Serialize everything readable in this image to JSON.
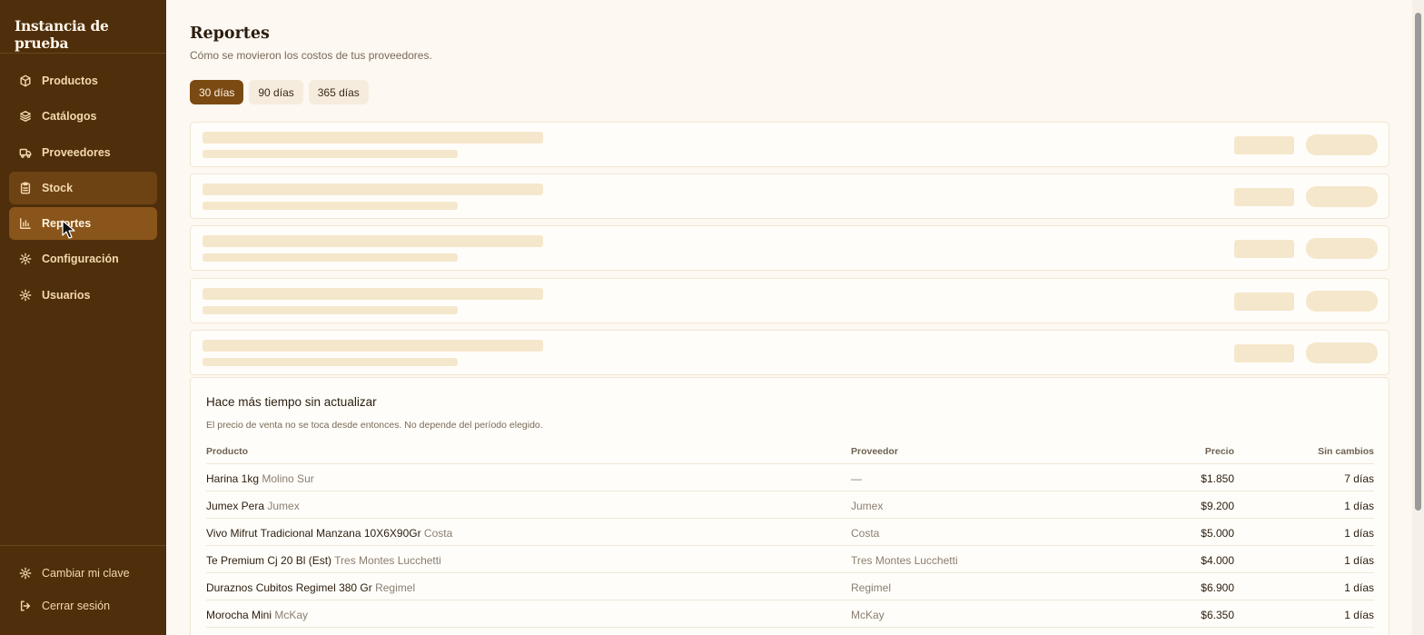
{
  "sidebar": {
    "brand": "Instancia de prueba",
    "items": [
      {
        "label": "Productos",
        "icon": "box-icon"
      },
      {
        "label": "Catálogos",
        "icon": "layers-icon"
      },
      {
        "label": "Proveedores",
        "icon": "truck-icon"
      },
      {
        "label": "Stock",
        "icon": "clipboard-icon"
      },
      {
        "label": "Reportes",
        "icon": "bar-chart-icon"
      },
      {
        "label": "Configuración",
        "icon": "gear-icon"
      },
      {
        "label": "Usuarios",
        "icon": "gear-icon"
      }
    ],
    "bottom": [
      {
        "label": "Cambiar mi clave",
        "icon": "gear-icon"
      },
      {
        "label": "Cerrar sesión",
        "icon": "logout-icon"
      }
    ]
  },
  "header": {
    "title": "Reportes",
    "subtitle": "Cómo se movieron los costos de tus proveedores."
  },
  "tabs": [
    "30 días",
    "90 días",
    "365 días"
  ],
  "panel": {
    "title": "Hace más tiempo sin actualizar",
    "subtitle": "El precio de venta no se toca desde entonces. No depende del período elegido.",
    "columns": {
      "product": "Producto",
      "supplier": "Proveedor",
      "price": "Precio",
      "days": "Sin cambios"
    },
    "rows": [
      {
        "product": "Harina 1kg",
        "brand": "Molino Sur",
        "supplier": "—",
        "price": "$1.850",
        "days": "7 días"
      },
      {
        "product": "Jumex Pera",
        "brand": "Jumex",
        "supplier": "Jumex",
        "price": "$9.200",
        "days": "1 días"
      },
      {
        "product": "Vivo Mifrut Tradicional Manzana 10X6X90Gr",
        "brand": "Costa",
        "supplier": "Costa",
        "price": "$5.000",
        "days": "1 días"
      },
      {
        "product": "Te Premium Cj 20 Bl (Est)",
        "brand": "Tres Montes Lucchetti",
        "supplier": "Tres Montes Lucchetti",
        "price": "$4.000",
        "days": "1 días"
      },
      {
        "product": "Duraznos Cubitos Regimel 380 Gr",
        "brand": "Regimel",
        "supplier": "Regimel",
        "price": "$6.900",
        "days": "1 días"
      },
      {
        "product": "Morocha Mini",
        "brand": "McKay",
        "supplier": "McKay",
        "price": "$6.350",
        "days": "1 días"
      }
    ]
  },
  "colors": {
    "sidebar": "#4f2e0b",
    "accent": "#7a4a12",
    "background": "#fdf8f1",
    "skeleton": "#f5e7cc"
  }
}
